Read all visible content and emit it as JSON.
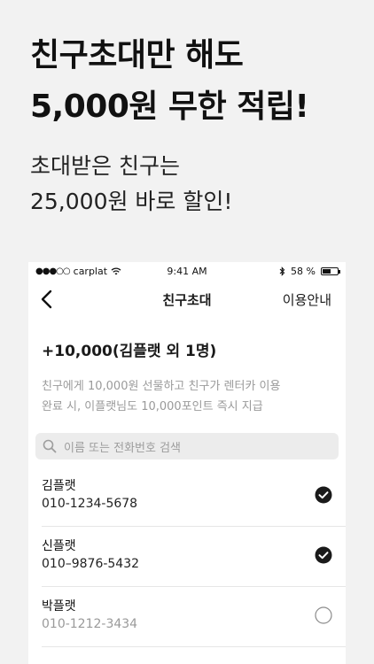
{
  "promo": {
    "headline": [
      "친구초대만 해도",
      "5,000원 무한 적립!"
    ],
    "subline": [
      "초대받은 친구는",
      "25,000원 바로 할인!"
    ]
  },
  "status_bar": {
    "signal": "●●●○○",
    "carrier": "carplat",
    "wifi_icon": "wifi-icon",
    "time": "9:41 AM",
    "bluetooth_icon": "bluetooth-icon",
    "battery_text": "58 %",
    "battery_level": 0.58
  },
  "nav": {
    "back_icon": "chevron-left-icon",
    "title": "친구초대",
    "guide_label": "이용안내"
  },
  "summary": {
    "title": "+10,000(김플랫 외 1명)",
    "description": [
      "친구에게 10,000원 선물하고 친구가 렌터카 이용",
      "완료 시, 이플랫님도 10,000포인트 즉시 지급"
    ]
  },
  "search": {
    "placeholder": "이름 또는 전화번호 검색",
    "icon": "search-icon"
  },
  "friends": [
    {
      "name": "김플랫",
      "phone": "010-1234-5678",
      "checked": true
    },
    {
      "name": "신플랫",
      "phone": "010–9876-5432",
      "checked": true
    },
    {
      "name": "박플랫",
      "phone": "010-1212-3434",
      "checked": false
    }
  ],
  "colors": {
    "background": "#f2f2f2",
    "panel": "#ffffff",
    "check_fill": "#1a1a1a",
    "muted_text": "#9a9a9a"
  }
}
